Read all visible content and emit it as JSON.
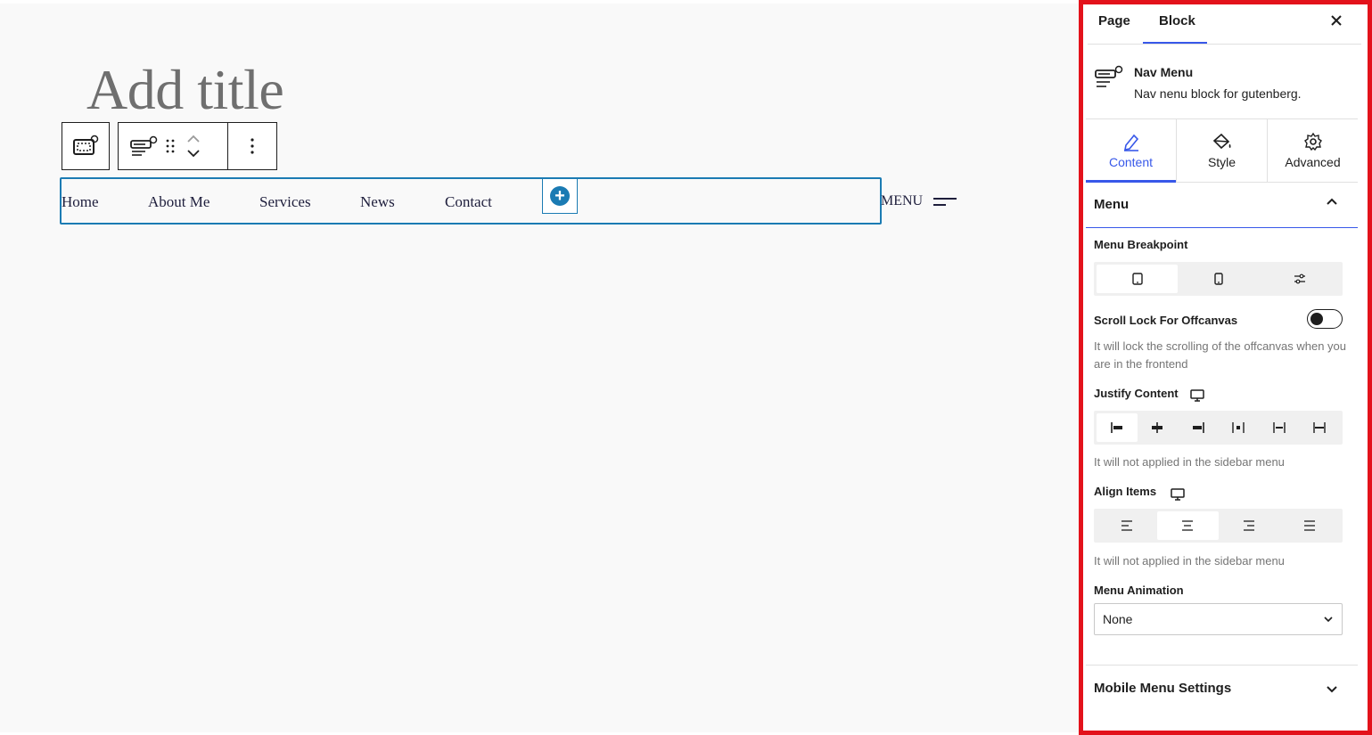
{
  "editor": {
    "title_placeholder": "Add title",
    "nav_items": [
      "Home",
      "About Me",
      "Services",
      "News",
      "Contact"
    ],
    "menu_toggle_label": "MENU"
  },
  "sidebar": {
    "tabs": [
      "Page",
      "Block"
    ],
    "active_tab": "Block",
    "block": {
      "name": "Nav Menu",
      "description": "Nav nenu block for gutenberg."
    },
    "panel_tabs": [
      "Content",
      "Style",
      "Advanced"
    ],
    "active_panel_tab": "Content",
    "menu_section": {
      "title": "Menu",
      "breakpoint_label": "Menu Breakpoint",
      "scroll_lock_label": "Scroll Lock For Offcanvas",
      "scroll_lock_help": "It will lock the scrolling of the offcanvas when you are in the frontend",
      "justify_label": "Justify Content",
      "justify_help": "It will not applied in the sidebar menu",
      "align_label": "Align Items",
      "align_help": "It will not applied in the sidebar menu",
      "animation_label": "Menu Animation",
      "animation_value": "None"
    },
    "mobile_section": {
      "title": "Mobile Menu Settings"
    }
  },
  "colors": {
    "accent": "#3858e9",
    "block_outline": "#1b7bb3",
    "highlight_border": "#e3121b"
  }
}
